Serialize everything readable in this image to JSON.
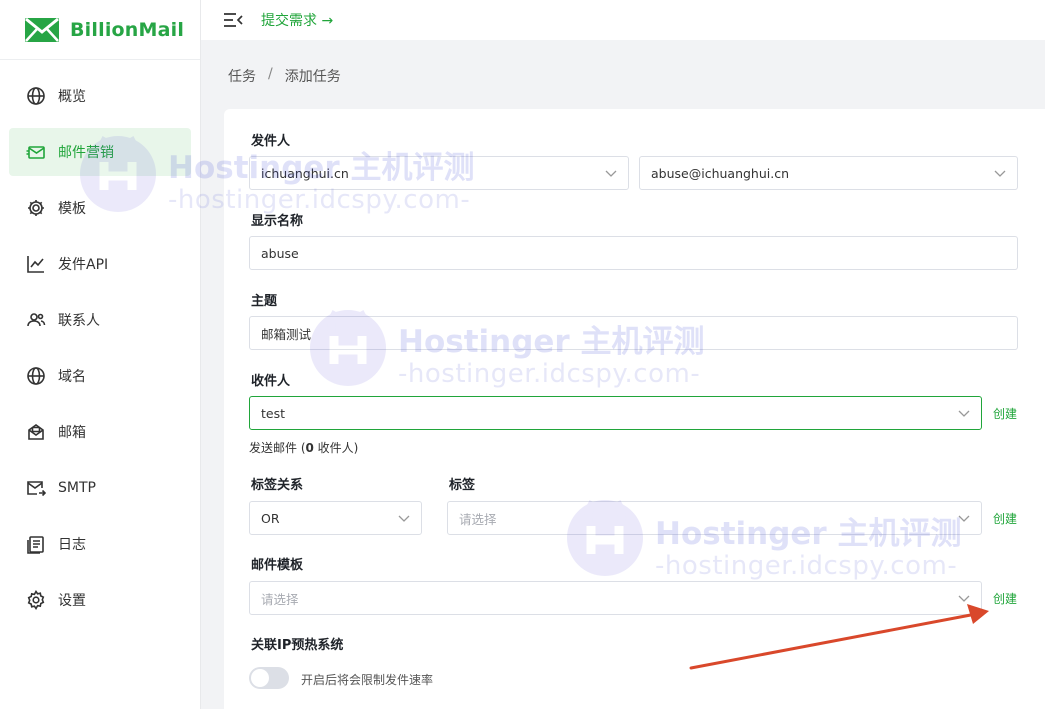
{
  "app": {
    "name": "BillionMail",
    "brand_color": "#27a545",
    "accent": "#20a53a"
  },
  "header": {
    "demand_link": "提交需求 →"
  },
  "sidebar": {
    "items": [
      {
        "label": "概览",
        "icon": "globe-icon",
        "active": false
      },
      {
        "label": "邮件营销",
        "icon": "mail-marketing-icon",
        "active": true
      },
      {
        "label": "模板",
        "icon": "gear-icon",
        "active": false
      },
      {
        "label": "发件API",
        "icon": "chart-line-icon",
        "active": false
      },
      {
        "label": "联系人",
        "icon": "contacts-icon",
        "active": false
      },
      {
        "label": "域名",
        "icon": "globe-icon",
        "active": false
      },
      {
        "label": "邮箱",
        "icon": "mailbox-icon",
        "active": false
      },
      {
        "label": "SMTP",
        "icon": "smtp-mail-icon",
        "active": false
      },
      {
        "label": "日志",
        "icon": "log-icon",
        "active": false
      },
      {
        "label": "设置",
        "icon": "settings-icon",
        "active": false
      }
    ]
  },
  "breadcrumb": {
    "parent": "任务",
    "separator": "/",
    "current": "添加任务"
  },
  "form": {
    "sender": {
      "label": "发件人",
      "domain_value": "ichuanghui.cn",
      "address_value": "abuse@ichuanghui.cn"
    },
    "display_name": {
      "label": "显示名称",
      "value": "abuse"
    },
    "subject": {
      "label": "主题",
      "value": "邮箱测试"
    },
    "recipient": {
      "label": "收件人",
      "value": "test",
      "create": "创建",
      "hint_prefix": "发送邮件 (",
      "hint_count": "0",
      "hint_suffix": " 收件人)"
    },
    "tag_relation": {
      "label": "标签关系",
      "value": "OR"
    },
    "tags": {
      "label": "标签",
      "placeholder": "请选择",
      "create": "创建"
    },
    "template": {
      "label": "邮件模板",
      "placeholder": "请选择",
      "create": "创建"
    },
    "ip_warmup": {
      "label": "关联IP预热系统",
      "enabled": false,
      "description": "开启后将会限制发件速率"
    }
  },
  "watermark": {
    "title": "Hostinger 主机评测",
    "subtitle": "-hostinger.idcspy.com-"
  }
}
